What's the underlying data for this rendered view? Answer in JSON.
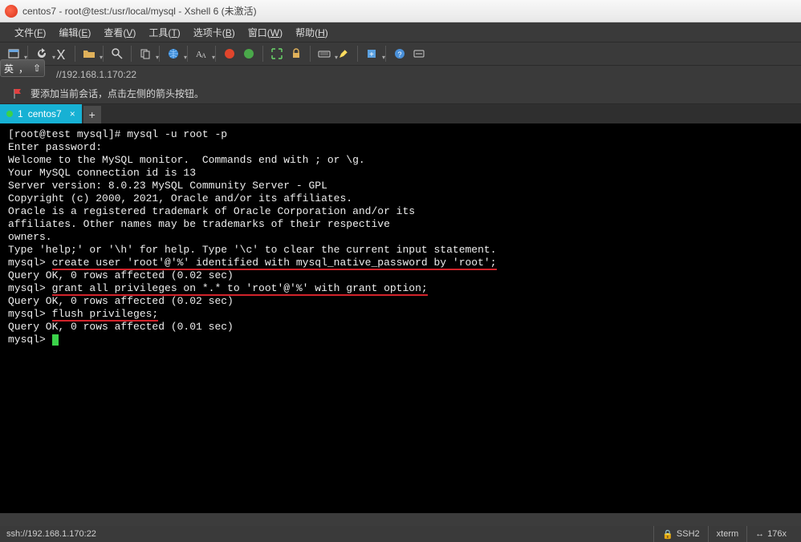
{
  "window": {
    "title": "centos7 - root@test:/usr/local/mysql - Xshell 6 (未激活)"
  },
  "menu": {
    "items": [
      {
        "label": "文件",
        "accel": "F"
      },
      {
        "label": "编辑",
        "accel": "E"
      },
      {
        "label": "查看",
        "accel": "V"
      },
      {
        "label": "工具",
        "accel": "T"
      },
      {
        "label": "选项卡",
        "accel": "B"
      },
      {
        "label": "窗口",
        "accel": "W"
      },
      {
        "label": "帮助",
        "accel": "H"
      }
    ]
  },
  "ime": {
    "lang": "英",
    "arrow": "⇧"
  },
  "address": {
    "value": "//192.168.1.170:22"
  },
  "hint": {
    "text": "要添加当前会话，点击左侧的箭头按钮。"
  },
  "tabs": {
    "items": [
      {
        "index": "1",
        "label": "centos7"
      }
    ],
    "add": "+"
  },
  "terminal": {
    "lines": [
      "[root@test mysql]# mysql -u root -p",
      "Enter password: ",
      "Welcome to the MySQL monitor.  Commands end with ; or \\g.",
      "Your MySQL connection id is 13",
      "Server version: 8.0.23 MySQL Community Server - GPL",
      "",
      "Copyright (c) 2000, 2021, Oracle and/or its affiliates.",
      "",
      "Oracle is a registered trademark of Oracle Corporation and/or its",
      "affiliates. Other names may be trademarks of their respective",
      "owners.",
      "",
      "Type 'help;' or '\\h' for help. Type '\\c' to clear the current input statement.",
      ""
    ],
    "cmd1_prefix": "mysql> ",
    "cmd1_body": "create user 'root'@'%' identified with mysql_native_password by 'root';",
    "res1": "Query OK, 0 rows affected (0.02 sec)",
    "blank": "",
    "cmd2_prefix": "mysql> ",
    "cmd2_body": "grant all privileges on *.* to 'root'@'%' with grant option;",
    "res2": "Query OK, 0 rows affected (0.02 sec)",
    "cmd3_prefix": "mysql> ",
    "cmd3_body": "flush privileges;",
    "res3": "Query OK, 0 rows affected (0.01 sec)",
    "prompt": "mysql> "
  },
  "status": {
    "left": "ssh://192.168.1.170:22",
    "proto": "SSH2",
    "term": "xterm",
    "size": "176x"
  }
}
